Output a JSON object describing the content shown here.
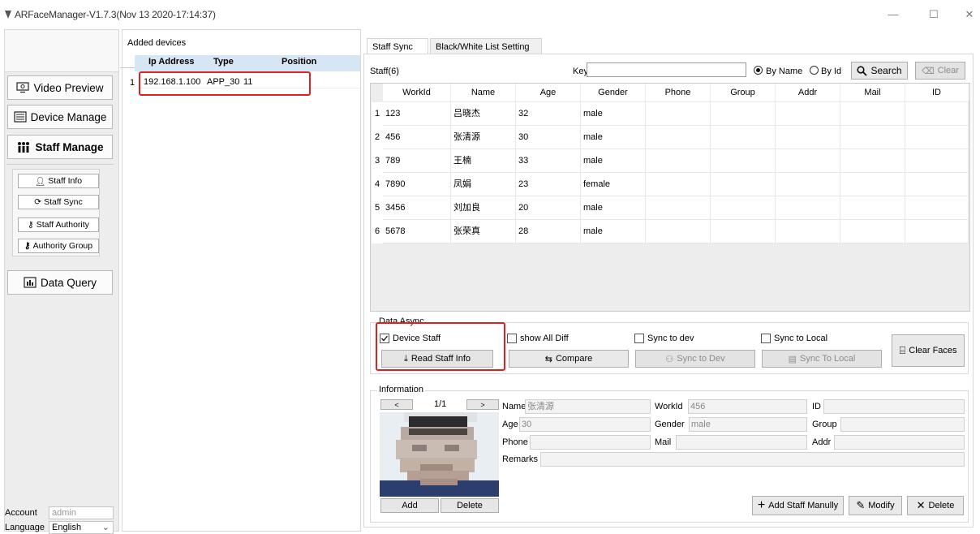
{
  "window": {
    "title": "ARFaceManager-V1.7.3(Nov 13 2020-17:14:37)",
    "minimize": "—",
    "maximize": "☐",
    "close": "✕"
  },
  "nav": {
    "video_preview": "Video Preview",
    "device_manage": "Device Manage",
    "staff_manage": "Staff Manage",
    "staff_info": "Staff Info",
    "staff_sync": "Staff Sync",
    "staff_authority": "Staff Authority",
    "authority_group": "Authority Group",
    "data_query": "Data Query"
  },
  "account": {
    "label": "Account",
    "value": "admin",
    "language_label": "Language",
    "language_value": "English"
  },
  "devices": {
    "title": "Added devices",
    "columns": [
      "Ip Address",
      "Type",
      "Position"
    ],
    "rows": [
      {
        "index": "1",
        "ip": "192.168.1.100",
        "type": "APP_30",
        "position": "11"
      }
    ]
  },
  "tabs": {
    "staff_sync": "Staff Sync",
    "bw_list": "Black/White List Setting"
  },
  "search": {
    "staff_count": "Staff(6)",
    "key_label": "Key",
    "key_value": "",
    "by_name": "By Name",
    "by_id": "By Id",
    "search_btn": "Search",
    "clear_btn": "Clear"
  },
  "staff_table": {
    "columns": [
      "WorkId",
      "Name",
      "Age",
      "Gender",
      "Phone",
      "Group",
      "Addr",
      "Mail",
      "ID"
    ],
    "rows": [
      {
        "n": "1",
        "workid": "123",
        "name": "吕晓杰",
        "age": "32",
        "gender": "male"
      },
      {
        "n": "2",
        "workid": "456",
        "name": "张清源",
        "age": "30",
        "gender": "male"
      },
      {
        "n": "3",
        "workid": "789",
        "name": "王楠",
        "age": "33",
        "gender": "male"
      },
      {
        "n": "4",
        "workid": "7890",
        "name": "凤娟",
        "age": "23",
        "gender": "female"
      },
      {
        "n": "5",
        "workid": "3456",
        "name": "刘加良",
        "age": "20",
        "gender": "male"
      },
      {
        "n": "6",
        "workid": "5678",
        "name": "张荣真",
        "age": "28",
        "gender": "male"
      }
    ]
  },
  "data_async": {
    "title": "Data Async",
    "device_staff": "Device Staff",
    "device_staff_checked": true,
    "show_all_diff": "show All Diff",
    "sync_to_dev": "Sync to dev",
    "sync_to_local": "Sync to Local",
    "read_staff_info": "Read Staff Info",
    "compare": "Compare",
    "sync_to_dev_btn": "Sync to Dev",
    "sync_to_local_btn": "Sync To Local",
    "clear_faces": "Clear Faces"
  },
  "information": {
    "title": "Information",
    "prev": "<",
    "page": "1/1",
    "next": ">",
    "name_label": "Name",
    "name_value": "张清源",
    "workid_label": "WorkId",
    "workid_value": "456",
    "id_label": "ID",
    "id_value": "",
    "age_label": "Age",
    "age_value": "30",
    "gender_label": "Gender",
    "gender_value": "male",
    "group_label": "Group",
    "group_value": "",
    "phone_label": "Phone",
    "phone_value": "",
    "mail_label": "Mail",
    "mail_value": "",
    "addr_label": "Addr",
    "addr_value": "",
    "remarks_label": "Remarks",
    "remarks_value": "",
    "add_btn": "Add",
    "delete_photo_btn": "Delete",
    "add_staff_btn": "Add Staff Manully",
    "modify_btn": "Modify",
    "delete_btn": "Delete"
  },
  "colors": {
    "highlight": "#e02020",
    "header_bg": "#d7e6f5",
    "panel_bg": "#ededed"
  }
}
